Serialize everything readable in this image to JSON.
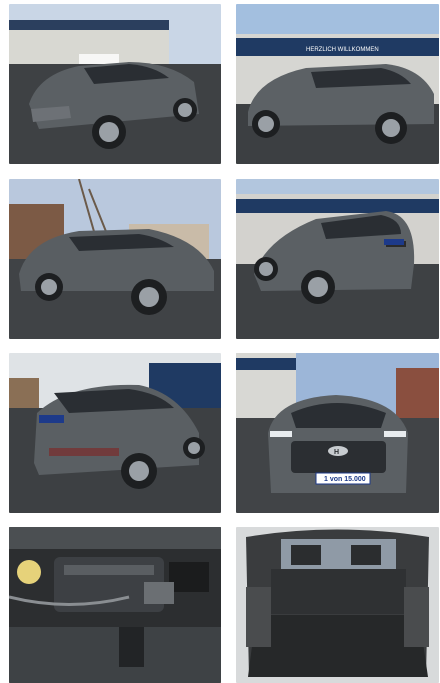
{
  "gallery": {
    "photos": [
      {
        "alt": "front-left exterior view"
      },
      {
        "alt": "right side exterior view at dealership"
      },
      {
        "alt": "front-right exterior view on street"
      },
      {
        "alt": "rear-right exterior view at dealership"
      },
      {
        "alt": "rear-left exterior view"
      },
      {
        "alt": "front exterior view"
      },
      {
        "alt": "engine bay"
      },
      {
        "alt": "trunk interior"
      }
    ],
    "signs": {
      "dealer_banner": "HERZLICH WILLKOMMEN",
      "front_plate": "1 von 15.000",
      "brand_mark": "H"
    }
  },
  "colors": {
    "car_body": "#5a5f63",
    "sky": "#9fb8d8",
    "asphalt": "#3f4245",
    "dealer_navy": "#1f3a63"
  }
}
